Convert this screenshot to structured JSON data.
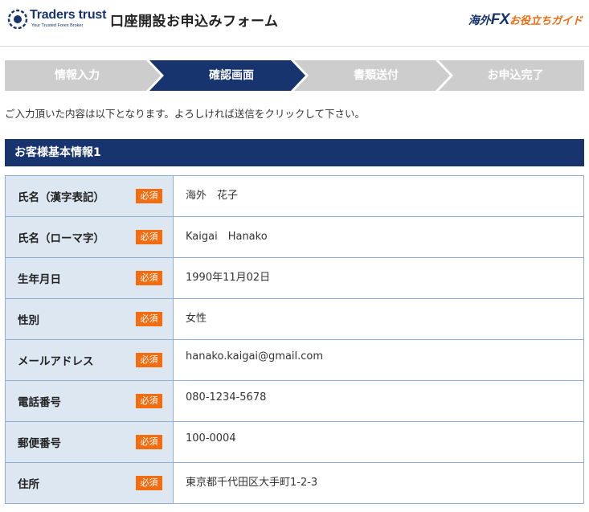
{
  "header": {
    "brand_name": "Traders trust",
    "brand_tagline": "Your Trusted Forex Broker",
    "page_title": "口座開設お申込みフォーム",
    "guide_logo": {
      "part1": "海外",
      "part2": "FX",
      "part3": "お役立ちガイド"
    }
  },
  "steps": [
    {
      "label": "情報入力",
      "active": false
    },
    {
      "label": "確認画面",
      "active": true
    },
    {
      "label": "書類送付",
      "active": false
    },
    {
      "label": "お申込完了",
      "active": false
    }
  ],
  "notice": "ご入力頂いた内容は以下となります。よろしければ送信をクリックして下さい。",
  "section": {
    "title": "お客様基本情報1",
    "required_label": "必須",
    "rows": [
      {
        "label": "氏名（漢字表記）",
        "value": "海外　花子"
      },
      {
        "label": "氏名（ローマ字）",
        "value": "Kaigai　Hanako"
      },
      {
        "label": "生年月日",
        "value": "1990年11月02日"
      },
      {
        "label": "性別",
        "value": "女性"
      },
      {
        "label": "メールアドレス",
        "value": "hanako.kaigai@gmail.com"
      },
      {
        "label": "電話番号",
        "value": "080-1234-5678"
      },
      {
        "label": "郵便番号",
        "value": "100-0004"
      },
      {
        "label": "住所",
        "value": "東京都千代田区大手町1-2-3"
      }
    ]
  },
  "colors": {
    "primary": "#17346f",
    "accent": "#f36c0f",
    "step_inactive": "#cdcdcd",
    "label_bg": "#dce7f2",
    "border": "#8fb0d4"
  }
}
